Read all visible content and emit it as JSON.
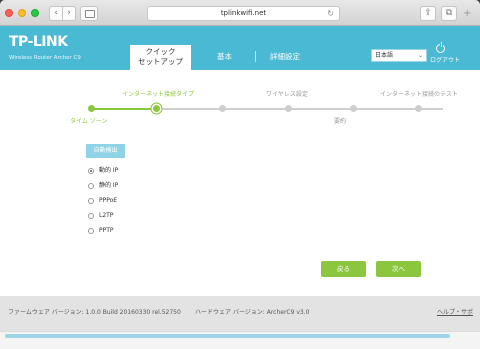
{
  "browser": {
    "back_icon": "‹",
    "forward_icon": "›",
    "url": "tplinkwifi.net",
    "reload_icon": "↻",
    "share_icon": "⇪",
    "tabs_icon": "⧉",
    "new_tab_icon": "+"
  },
  "header": {
    "logo": "TP-LINK",
    "model": "Wireless Router Archer C9",
    "tabs": {
      "quick_setup": "クイック\nセットアップ",
      "basic": "基本",
      "advanced": "詳細設定"
    },
    "language": "日本語",
    "logout": "ログアウト",
    "colors": {
      "brand": "#4ab9d4",
      "accent": "#8cc63f"
    }
  },
  "wizard": {
    "steps_top": {
      "internet_type": "インターネット接続タイプ",
      "wireless": "ワイヤレス設定",
      "test": "インターネット接続のテスト"
    },
    "steps_bottom": {
      "timezone": "タイム ゾーン",
      "summary": "要約"
    },
    "auto_detect": "自動検出",
    "options": [
      {
        "label": "動的 IP",
        "checked": true
      },
      {
        "label": "静的 IP",
        "checked": false
      },
      {
        "label": "PPPoE",
        "checked": false
      },
      {
        "label": "L2TP",
        "checked": false
      },
      {
        "label": "PPTP",
        "checked": false
      }
    ],
    "back": "戻る",
    "next": "次へ"
  },
  "footer": {
    "firmware": "ファームウェア バージョン: 1.0.0 Build 20160330 rel.52750",
    "hardware": "ハードウェア バージョン: ArcherC9 v3.0",
    "help": "ヘルプ・サポ"
  }
}
